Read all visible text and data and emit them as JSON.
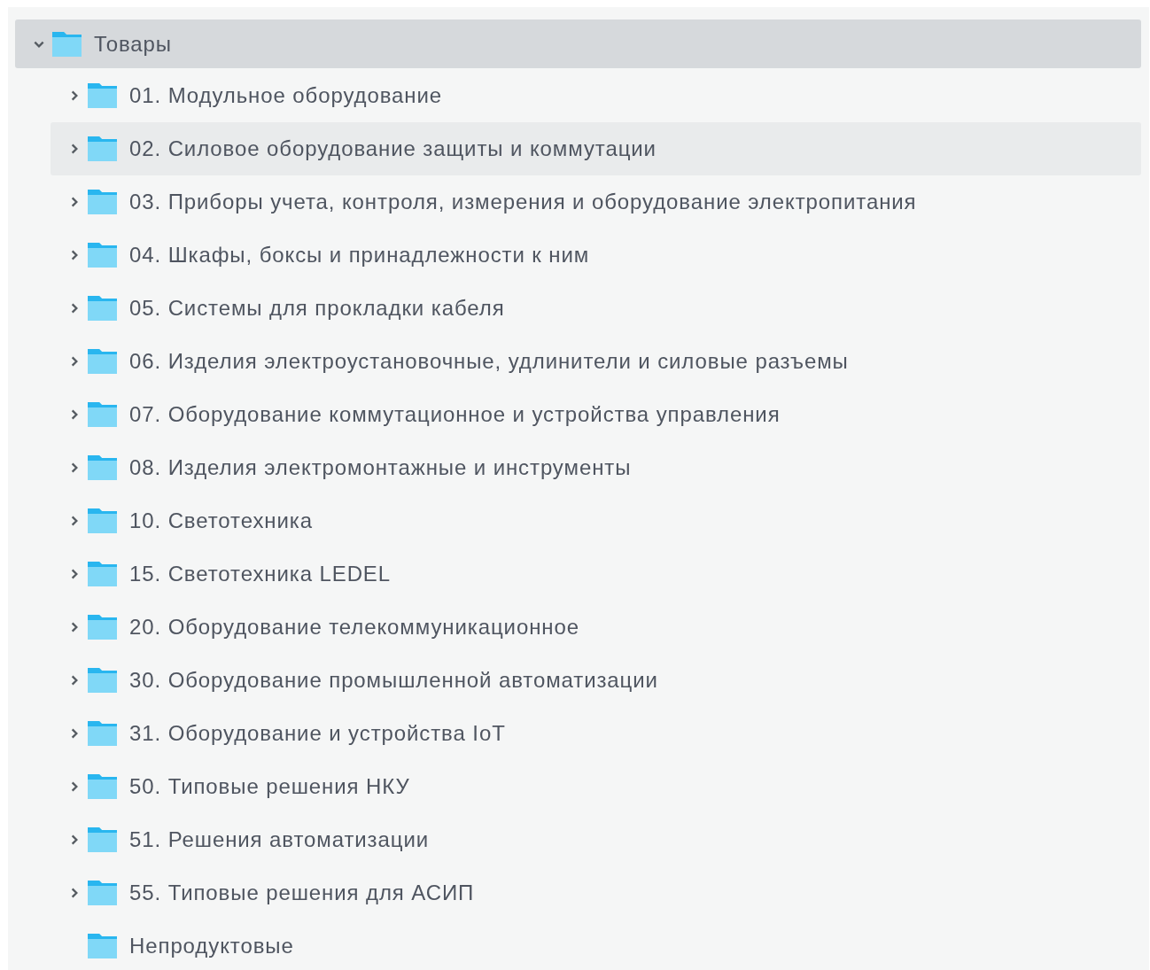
{
  "tree": [
    {
      "label": "Товары",
      "expanded": true,
      "expandable": true,
      "selected": true,
      "hovered": false,
      "children": [
        {
          "label": "01. Модульное оборудование",
          "expandable": true,
          "expanded": false,
          "selected": false,
          "hovered": false
        },
        {
          "label": "02. Силовое оборудование защиты и коммутации",
          "expandable": true,
          "expanded": false,
          "selected": false,
          "hovered": true
        },
        {
          "label": "03. Приборы учета, контроля, измерения и оборудование электропитания",
          "expandable": true,
          "expanded": false,
          "selected": false,
          "hovered": false
        },
        {
          "label": "04. Шкафы, боксы и принадлежности к ним",
          "expandable": true,
          "expanded": false,
          "selected": false,
          "hovered": false
        },
        {
          "label": "05. Системы для прокладки кабеля",
          "expandable": true,
          "expanded": false,
          "selected": false,
          "hovered": false
        },
        {
          "label": "06. Изделия электроустановочные, удлинители и силовые разъемы",
          "expandable": true,
          "expanded": false,
          "selected": false,
          "hovered": false
        },
        {
          "label": "07. Оборудование коммутационное и устройства управления",
          "expandable": true,
          "expanded": false,
          "selected": false,
          "hovered": false
        },
        {
          "label": "08. Изделия электромонтажные и инструменты",
          "expandable": true,
          "expanded": false,
          "selected": false,
          "hovered": false
        },
        {
          "label": "10. Светотехника",
          "expandable": true,
          "expanded": false,
          "selected": false,
          "hovered": false
        },
        {
          "label": "15. Светотехника LEDEL",
          "expandable": true,
          "expanded": false,
          "selected": false,
          "hovered": false
        },
        {
          "label": "20. Оборудование телекоммуникационное",
          "expandable": true,
          "expanded": false,
          "selected": false,
          "hovered": false
        },
        {
          "label": "30. Оборудование промышленной автоматизации",
          "expandable": true,
          "expanded": false,
          "selected": false,
          "hovered": false
        },
        {
          "label": "31. Оборудование и устройства IoT",
          "expandable": true,
          "expanded": false,
          "selected": false,
          "hovered": false
        },
        {
          "label": "50. Типовые решения НКУ",
          "expandable": true,
          "expanded": false,
          "selected": false,
          "hovered": false
        },
        {
          "label": "51. Решения автоматизации",
          "expandable": true,
          "expanded": false,
          "selected": false,
          "hovered": false
        },
        {
          "label": "55. Типовые решения для АСИП",
          "expandable": true,
          "expanded": false,
          "selected": false,
          "hovered": false
        },
        {
          "label": "Непродуктовые",
          "expandable": false,
          "selected": false,
          "hovered": false
        }
      ]
    }
  ]
}
